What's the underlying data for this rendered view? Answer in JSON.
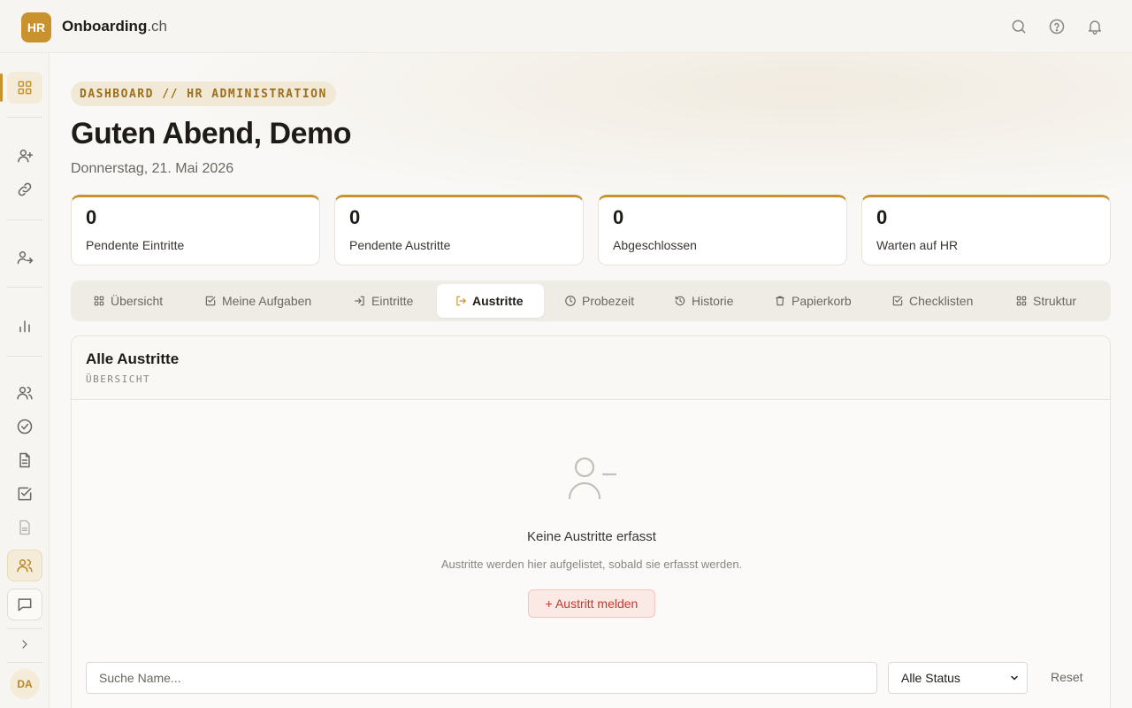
{
  "app": {
    "logo": "HR",
    "brand_main": "Onboarding",
    "brand_suffix": ".ch"
  },
  "topbar": {
    "icons": [
      "search-icon",
      "help-icon",
      "bell-icon"
    ]
  },
  "sidebar": {
    "icons": [
      "grid-icon",
      "user-plus-icon",
      "link-icon",
      "user-exit-icon",
      "bar-chart-icon",
      "users-icon",
      "check-circle-icon",
      "document-icon",
      "checkbox-icon",
      "file-icon",
      "team-icon",
      "message-icon",
      "chevron-right-icon"
    ],
    "avatar": "DA"
  },
  "header": {
    "breadcrumb": "DASHBOARD // HR ADMINISTRATION",
    "greeting": "Guten Abend, Demo",
    "date": "Donnerstag, 21. Mai 2026"
  },
  "stats": [
    {
      "value": "0",
      "label": "Pendente Eintritte"
    },
    {
      "value": "0",
      "label": "Pendente Austritte"
    },
    {
      "value": "0",
      "label": "Abgeschlossen"
    },
    {
      "value": "0",
      "label": "Warten auf HR"
    }
  ],
  "tabs": [
    {
      "label": "Übersicht",
      "icon": "grid-icon"
    },
    {
      "label": "Meine Aufgaben",
      "icon": "checkbox-icon"
    },
    {
      "label": "Eintritte",
      "icon": "login-icon"
    },
    {
      "label": "Austritte",
      "icon": "logout-icon",
      "active": true
    },
    {
      "label": "Probezeit",
      "icon": "clock-icon"
    },
    {
      "label": "Historie",
      "icon": "history-icon"
    },
    {
      "label": "Papierkorb",
      "icon": "trash-icon"
    },
    {
      "label": "Checklisten",
      "icon": "checkbox-icon"
    },
    {
      "label": "Struktur",
      "icon": "grid-icon"
    }
  ],
  "panel": {
    "title": "Alle Austritte",
    "subtitle": "ÜBERSICHT",
    "empty_title": "Keine Austritte erfasst",
    "empty_text": "Austritte werden hier aufgelistet, sobald sie erfasst werden.",
    "empty_button": "+ Austritt melden"
  },
  "filters": {
    "search_placeholder": "Suche Name...",
    "status_value": "Alle Status",
    "reset_label": "Reset"
  },
  "colors": {
    "accent": "#c9922c",
    "danger": "#c23b2b",
    "background": "#f9f8f6"
  }
}
